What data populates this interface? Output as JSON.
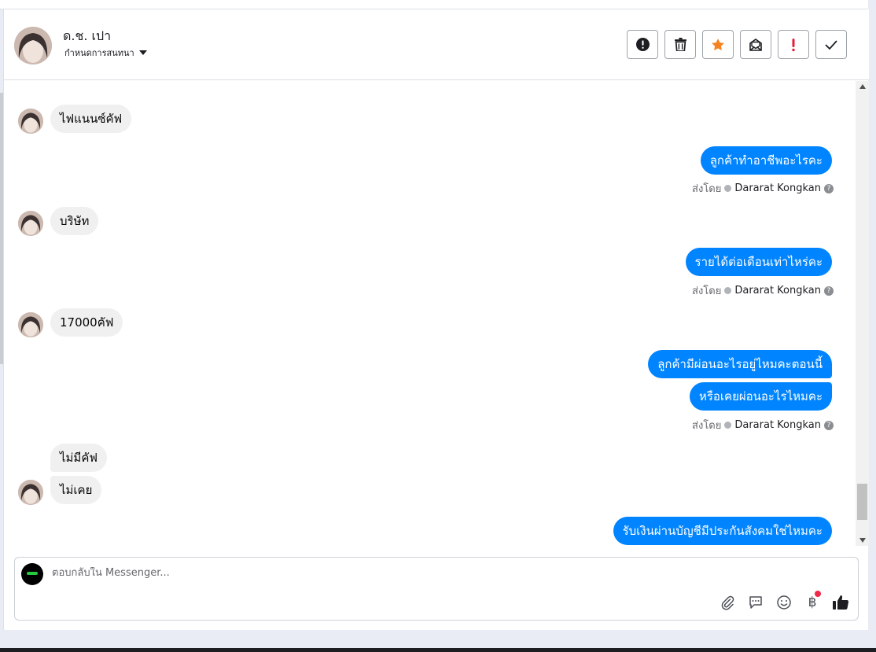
{
  "header": {
    "contact_name": "ด.ช. เปา",
    "assign_label": "กำหนดการสนทนา",
    "actions": [
      "spam-alert",
      "delete",
      "star",
      "mark-unread",
      "follow-up",
      "done"
    ]
  },
  "messages": {
    "in1": "ไฟแนนซ์คัฟ",
    "out1": "ลูกค้าทำอาชีพอะไรคะ",
    "in2": "บริษัท",
    "out2": "รายได้ต่อเดือนเท่าไหร่คะ",
    "in3": "17000คัฟ",
    "out3a": "ลูกค้ามีผ่อนอะไรอยู่ไหมคะตอนนี้",
    "out3b": "หรือเคยผ่อนอะไรไหมคะ",
    "in4a": "ไม่มีคัฟ",
    "in4b": "ไม่เคย",
    "out4": "รับเงินผ่านบัญชีมีประกันสังคมใช่ไหมคะ"
  },
  "sent_by": {
    "prefix": "ส่งโดย",
    "agent": "Dararat Kongkan",
    "help": "?"
  },
  "composer": {
    "placeholder": "ตอบกลับใน Messenger...",
    "tools": [
      "paperclip-icon",
      "saved-reply-icon",
      "emoji-icon",
      "payment-icon",
      "like-icon"
    ],
    "payment_glyph": "฿"
  },
  "colors": {
    "outgoing_bubble": "#0084ff",
    "incoming_bubble": "#f0f0f0",
    "star": "#f5821f",
    "alert_red": "#e41e3f"
  }
}
